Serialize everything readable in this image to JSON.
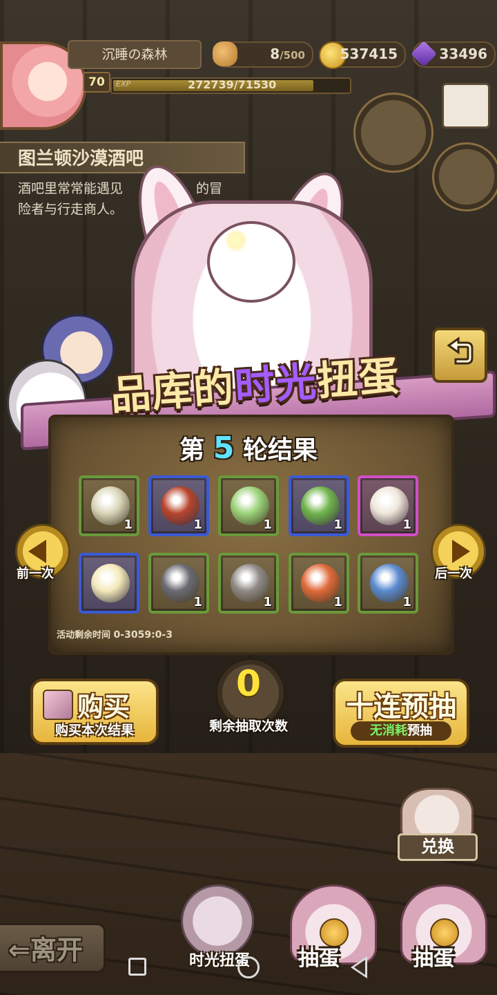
{
  "status_bar": {
    "area_name": "沉睡の森林",
    "player_level": "70",
    "exp_label": "EXP",
    "exp_text": "272739/71530",
    "exp_progress": 0.86,
    "stamina_current": "8",
    "stamina_max": "/500",
    "gold": "537415",
    "gems": "33496"
  },
  "location": {
    "title": "图兰顿沙漠酒吧",
    "desc_line1": "酒吧里常常能遇见",
    "desc_line1_end": "的冒",
    "desc_line2": "险者与行走商人。"
  },
  "banner": {
    "title_pre": "品库的",
    "title_hl": "时光",
    "title_post": "扭蛋"
  },
  "results": {
    "round_prefix": "第",
    "round_number": "5",
    "round_suffix": "轮结果",
    "items": [
      {
        "name": "egg-white",
        "count": "1",
        "rarity": "g",
        "color": "#d9d6b8"
      },
      {
        "name": "strawberry-hat",
        "count": "1",
        "rarity": "b",
        "color": "#b8442c"
      },
      {
        "name": "egg-green",
        "count": "1",
        "rarity": "g",
        "color": "#9cd37a"
      },
      {
        "name": "cactus",
        "count": "1",
        "rarity": "b",
        "color": "#6fb54a"
      },
      {
        "name": "white-wing",
        "count": "1",
        "rarity": "p",
        "color": "#efe6da"
      },
      {
        "name": "lotus-crystal",
        "count": "",
        "rarity": "b",
        "color": "#f3e9b8"
      },
      {
        "name": "dark-egg",
        "count": "1",
        "rarity": "g",
        "color": "#6a6a72"
      },
      {
        "name": "grey-hair",
        "count": "1",
        "rarity": "g",
        "color": "#8f8a86"
      },
      {
        "name": "orange-crab",
        "count": "1",
        "rarity": "g",
        "color": "#e06a3a"
      },
      {
        "name": "blue-seed",
        "count": "1",
        "rarity": "g",
        "color": "#5a8ad0"
      }
    ],
    "timer_label": "活动剩余时间",
    "timer_value": "0-3059:0-3"
  },
  "nav": {
    "prev_label": "前一次",
    "next_label": "后一次"
  },
  "actions": {
    "buy_title": "购买",
    "buy_sub": "购买本次结果",
    "remaining_count": "0",
    "remaining_label": "剩余抽取次数",
    "ten_title": "十连预抽",
    "ten_sub_green": "无消耗",
    "ten_sub_white": "预抽"
  },
  "shop": {
    "exchange_label": "兑换",
    "time_machine_label": "时光扭蛋",
    "draw_label_1": "抽蛋",
    "draw_label_2": "抽蛋"
  },
  "leave_label": "离开"
}
